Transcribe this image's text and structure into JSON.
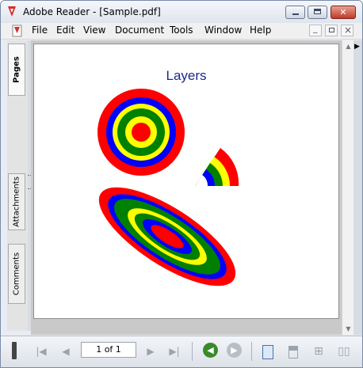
{
  "window": {
    "title": "Adobe Reader - [Sample.pdf]",
    "controls": {
      "minimize": "minimize-icon",
      "maximize": "maximize-icon",
      "close": "close-icon"
    }
  },
  "menubar": {
    "items": [
      "File",
      "Edit",
      "View",
      "Document",
      "Tools",
      "Window",
      "Help"
    ],
    "doc_controls": {
      "minimize": "_",
      "restore": "restore-icon",
      "close": "×"
    }
  },
  "navigation": {
    "tabs": [
      {
        "label": "Pages",
        "active": true
      },
      {
        "label": "Attachments",
        "active": false
      },
      {
        "label": "Comments",
        "active": false
      }
    ]
  },
  "document": {
    "page_title": "Layers",
    "ring_colors": [
      "#ff0000",
      "#0000ff",
      "#008000",
      "#ffff00"
    ]
  },
  "toolbar": {
    "page_field": "1 of 1"
  },
  "colors": {
    "accent": "#1a2a8a",
    "back_button": "#3a8a2a",
    "forward_button": "#b8bec6"
  }
}
